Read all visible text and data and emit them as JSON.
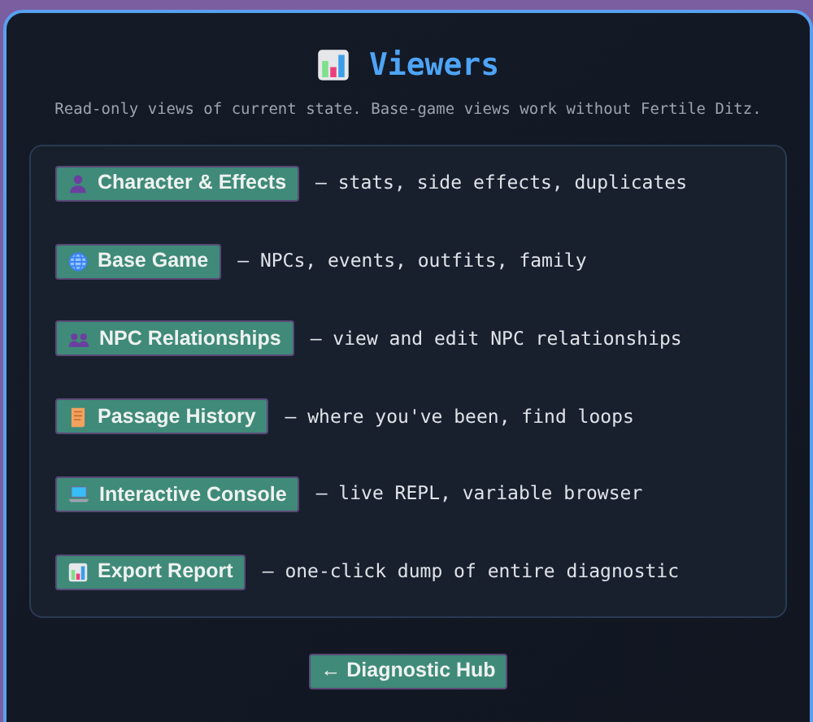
{
  "title": "Viewers",
  "subtitle": "Read-only views of current state. Base-game views work without Fertile Ditz.",
  "viewers": [
    {
      "label": "Character & Effects",
      "description": "— stats, side effects, duplicates"
    },
    {
      "label": "Base Game",
      "description": "— NPCs, events, outfits, family"
    },
    {
      "label": "NPC Relationships",
      "description": "— view and edit NPC relationships"
    },
    {
      "label": "Passage History",
      "description": "— where you've been, find loops"
    },
    {
      "label": "Interactive Console",
      "description": "— live REPL, variable browser"
    },
    {
      "label": "Export Report",
      "description": "— one-click dump of entire diagnostic"
    }
  ],
  "back_button": "← Diagnostic Hub"
}
